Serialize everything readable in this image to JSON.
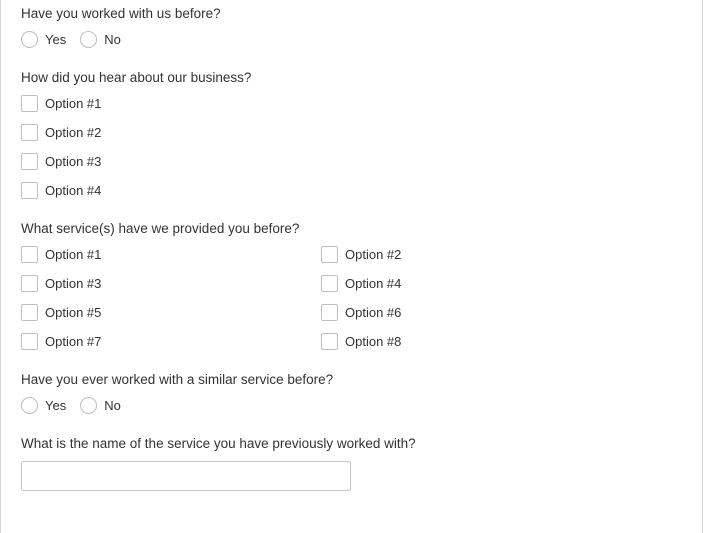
{
  "q1": {
    "label": "Have you worked with us before?",
    "options": [
      "Yes",
      "No"
    ]
  },
  "q2": {
    "label": "How did you hear about our business?",
    "options": [
      "Option #1",
      "Option #2",
      "Option #3",
      "Option #4"
    ]
  },
  "q3": {
    "label": "What service(s) have we provided you before?",
    "options": [
      "Option #1",
      "Option #2",
      "Option #3",
      "Option #4",
      "Option #5",
      "Option #6",
      "Option #7",
      "Option #8"
    ]
  },
  "q4": {
    "label": "Have you ever worked with a similar service before?",
    "options": [
      "Yes",
      "No"
    ]
  },
  "q5": {
    "label": "What is the name of the service you have previously worked with?",
    "value": ""
  }
}
